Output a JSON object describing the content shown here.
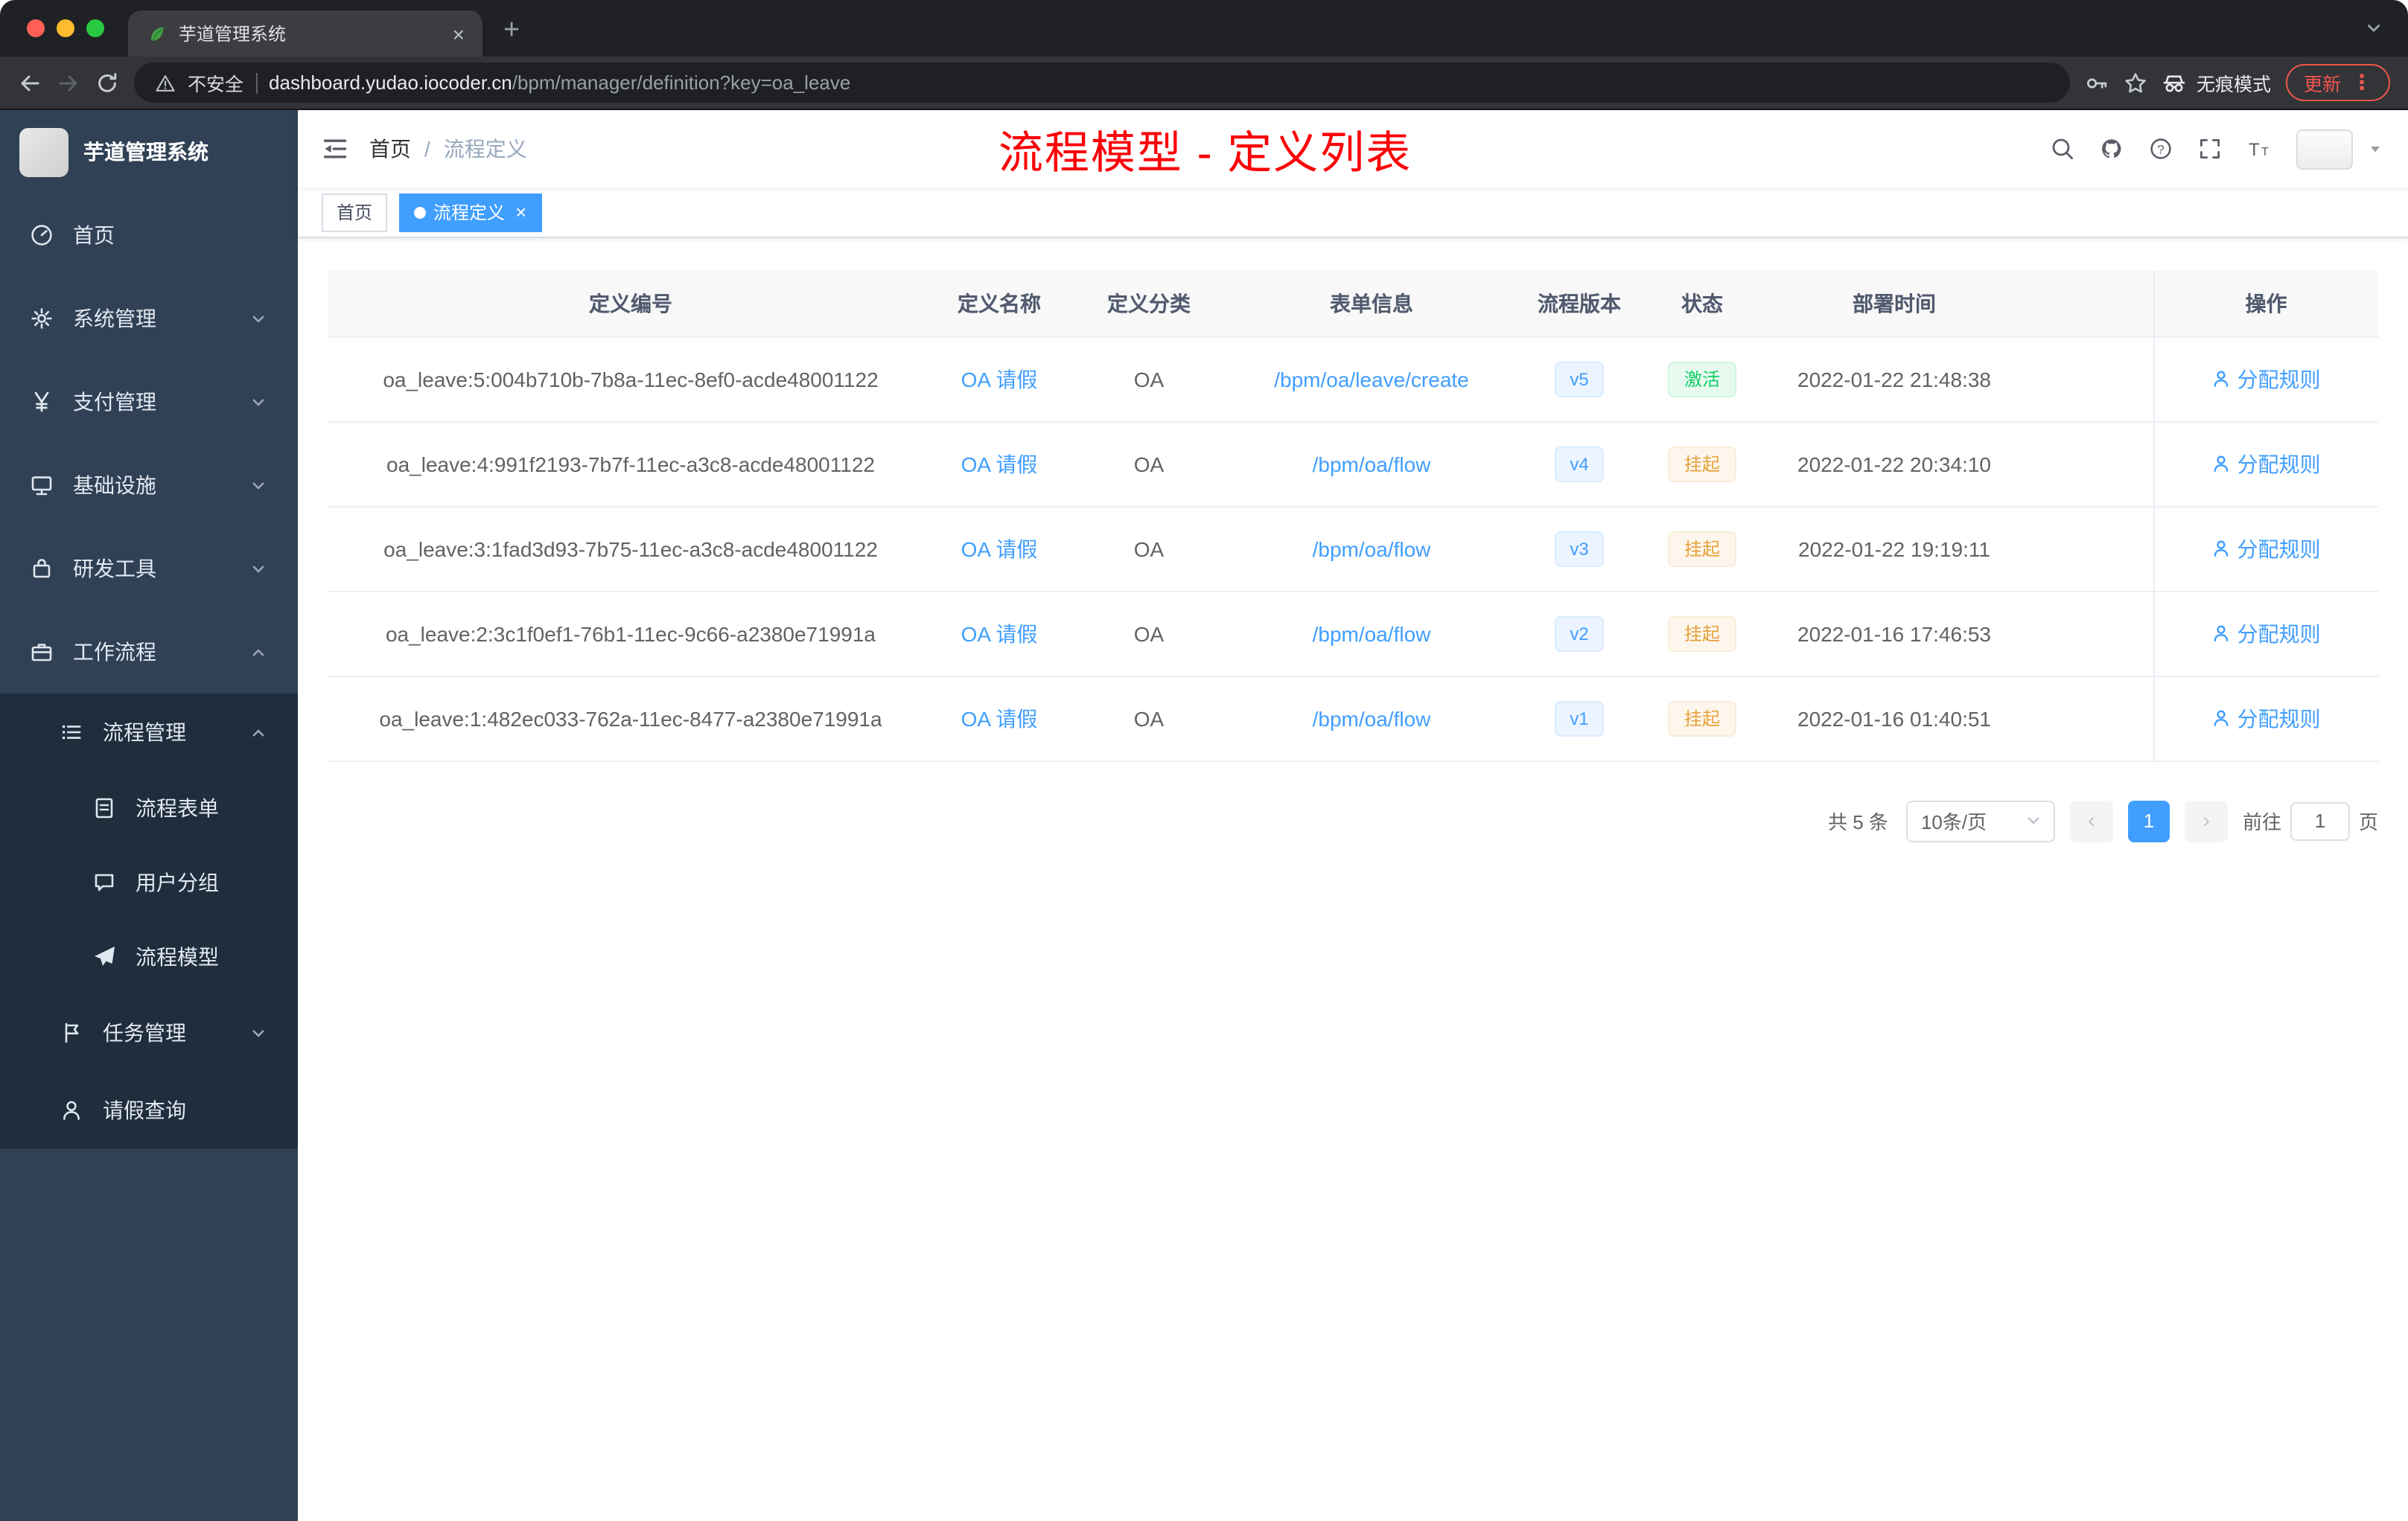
{
  "colors": {
    "accent": "#409eff",
    "sidebar_bg": "#304156",
    "submenu_bg": "#1f2d3d",
    "annotation_red": "#fb0007",
    "success_green": "#13ce66",
    "warning_orange": "#e6a23c"
  },
  "browser": {
    "tab_title": "芋道管理系统",
    "tab_close": "×",
    "new_tab": "+",
    "security_label": "不安全",
    "url_domain": "dashboard.yudao.iocoder.cn",
    "url_path": "/bpm/manager/definition?key=oa_leave",
    "incognito_label": "无痕模式",
    "update_label": "更新",
    "menu_dots": "⋮"
  },
  "sidebar": {
    "app_title": "芋道管理系统",
    "items": [
      {
        "label": "首页"
      },
      {
        "label": "系统管理"
      },
      {
        "label": "支付管理"
      },
      {
        "label": "基础设施"
      },
      {
        "label": "研发工具"
      },
      {
        "label": "工作流程"
      }
    ],
    "workflow": {
      "process_management": {
        "label": "流程管理"
      },
      "children": [
        {
          "label": "流程表单"
        },
        {
          "label": "用户分组"
        },
        {
          "label": "流程模型"
        }
      ],
      "task_management": {
        "label": "任务管理"
      },
      "leave_query": {
        "label": "请假查询"
      }
    }
  },
  "header": {
    "breadcrumb_home": "首页",
    "breadcrumb_sep": "/",
    "breadcrumb_current": "流程定义",
    "annotation": "流程模型 - 定义列表"
  },
  "tags": {
    "home": "首页",
    "active": "流程定义",
    "close": "×"
  },
  "table": {
    "headers": [
      "定义编号",
      "定义名称",
      "定义分类",
      "表单信息",
      "流程版本",
      "状态",
      "部署时间",
      "操作"
    ],
    "action_label": "分配规则",
    "rows": [
      {
        "id": "oa_leave:5:004b710b-7b8a-11ec-8ef0-acde48001122",
        "name": "OA 请假",
        "category": "OA",
        "form": "/bpm/oa/leave/create",
        "version": "v5",
        "status": "激活",
        "deploy_time": "2022-01-22 21:48:38"
      },
      {
        "id": "oa_leave:4:991f2193-7b7f-11ec-a3c8-acde48001122",
        "name": "OA 请假",
        "category": "OA",
        "form": "/bpm/oa/flow",
        "version": "v4",
        "status": "挂起",
        "deploy_time": "2022-01-22 20:34:10"
      },
      {
        "id": "oa_leave:3:1fad3d93-7b75-11ec-a3c8-acde48001122",
        "name": "OA 请假",
        "category": "OA",
        "form": "/bpm/oa/flow",
        "version": "v3",
        "status": "挂起",
        "deploy_time": "2022-01-22 19:19:11"
      },
      {
        "id": "oa_leave:2:3c1f0ef1-76b1-11ec-9c66-a2380e71991a",
        "name": "OA 请假",
        "category": "OA",
        "form": "/bpm/oa/flow",
        "version": "v2",
        "status": "挂起",
        "deploy_time": "2022-01-16 17:46:53"
      },
      {
        "id": "oa_leave:1:482ec033-762a-11ec-8477-a2380e71991a",
        "name": "OA 请假",
        "category": "OA",
        "form": "/bpm/oa/flow",
        "version": "v1",
        "status": "挂起",
        "deploy_time": "2022-01-16 01:40:51"
      }
    ]
  },
  "pagination": {
    "total": "共 5 条",
    "page_size": "10条/页",
    "prev": "‹",
    "current_page": "1",
    "next": "›",
    "goto_label": "前往",
    "goto_value": "1",
    "page_unit": "页"
  }
}
